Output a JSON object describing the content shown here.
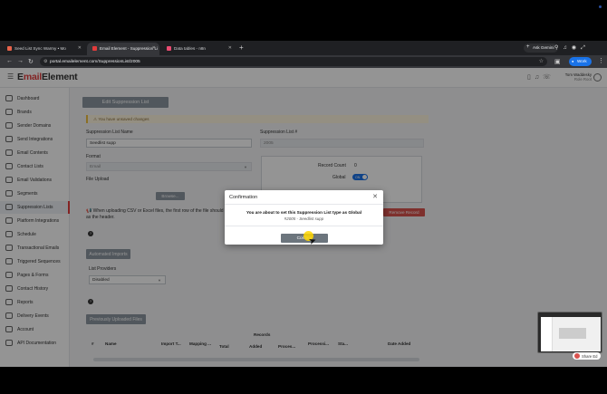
{
  "browser": {
    "tabs": [
      {
        "label": "Seed List Sync Warmy • Mo"
      },
      {
        "label": "Email Element - Suppression Li"
      },
      {
        "label": "Data tables - n8n"
      }
    ],
    "ask_gemini": "Ask Gemini",
    "url": "portal.emailelement.com/SuppressionList/2005",
    "work_label": "Work"
  },
  "app": {
    "logo_prefix": "E",
    "logo_highlight": "mail",
    "logo_suffix": "Element",
    "user_name": "Tom Waddesky",
    "user_role": "Role Root"
  },
  "sidebar": {
    "items": [
      {
        "label": "Dashboard"
      },
      {
        "label": "Brands"
      },
      {
        "label": "Sender Domains"
      },
      {
        "label": "Send Integrations"
      },
      {
        "label": "Email Contents"
      },
      {
        "label": "Contact Lists"
      },
      {
        "label": "Email Validations"
      },
      {
        "label": "Segments"
      },
      {
        "label": "Suppression Lists"
      },
      {
        "label": "Platform Integrations"
      },
      {
        "label": "Schedule"
      },
      {
        "label": "Transactional Emails"
      },
      {
        "label": "Triggered Sequences"
      },
      {
        "label": "Pages & Forms"
      },
      {
        "label": "Contact History"
      },
      {
        "label": "Reports"
      },
      {
        "label": "Delivery Events"
      },
      {
        "label": "Account"
      },
      {
        "label": "API Documentation"
      }
    ]
  },
  "main": {
    "title_button": "Edit Suppression List",
    "unsaved_warning": "You have unsaved changes",
    "name_label": "Suppression List Name",
    "name_value": "Seedlist supp",
    "id_label": "Suppression List #",
    "id_value": "2005",
    "format_label": "Format",
    "format_value": "Email",
    "file_upload_label": "File Upload",
    "browse_label": "Browse...",
    "record_count_label": "Record Count",
    "record_count_value": "0",
    "global_label": "Global",
    "toggle_text": "ON",
    "csv_note_line1": "When uploading CSV or Excel files, the first row of the file should b",
    "csv_note_line2": "as the header.",
    "remove_record": "Remove Record",
    "automated_imports": "Automated Imports",
    "list_providers_label": "List Providers",
    "list_providers_value": "Disabled",
    "previous_uploads": "Previously Uploaded Files",
    "records_group": "Records",
    "columns": {
      "num": "#",
      "name": "Name",
      "import_type": "Import T...",
      "mapping": "Mapping ...",
      "total": "Total",
      "added": "Added",
      "processed": "Proces...",
      "processing": "Processi...",
      "status": "Sta...",
      "date_added": "Date Added"
    }
  },
  "modal": {
    "title": "Confirmation",
    "message": "You are about to set this Suppression List type as Global",
    "subtext": "#2005 - Seedlist supp",
    "confirm": "Confirm"
  },
  "overlay_thumb": {
    "share_label": "Share Ed"
  }
}
